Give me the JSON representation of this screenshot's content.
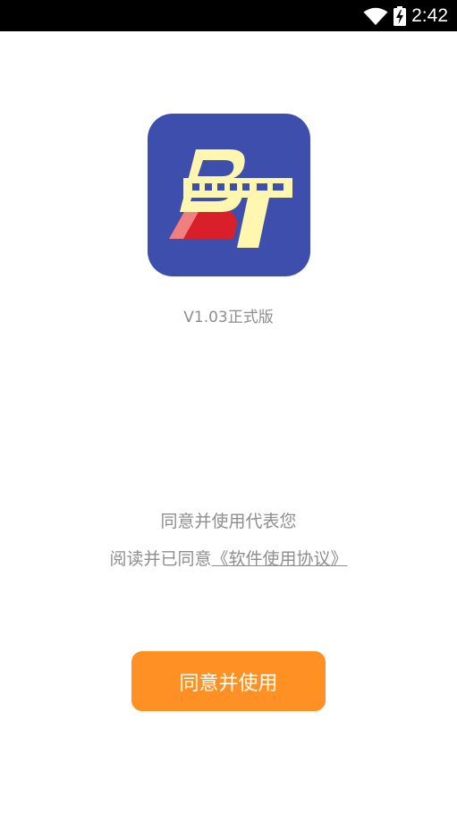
{
  "status_bar": {
    "time": "2:42",
    "icons": [
      "wifi-icon",
      "battery-charging-icon"
    ]
  },
  "app": {
    "logo_icon": "bt-logo-icon",
    "version": "V1.03正式版"
  },
  "consent": {
    "line1": "同意并使用代表您",
    "line2_prefix": "阅读并已同意",
    "agreement_link": "《软件使用协议》"
  },
  "button": {
    "label": "同意并使用",
    "color": "#ff9124"
  },
  "colors": {
    "icon_background": "#3d4eac",
    "text_gray": "#8e8e8e"
  }
}
